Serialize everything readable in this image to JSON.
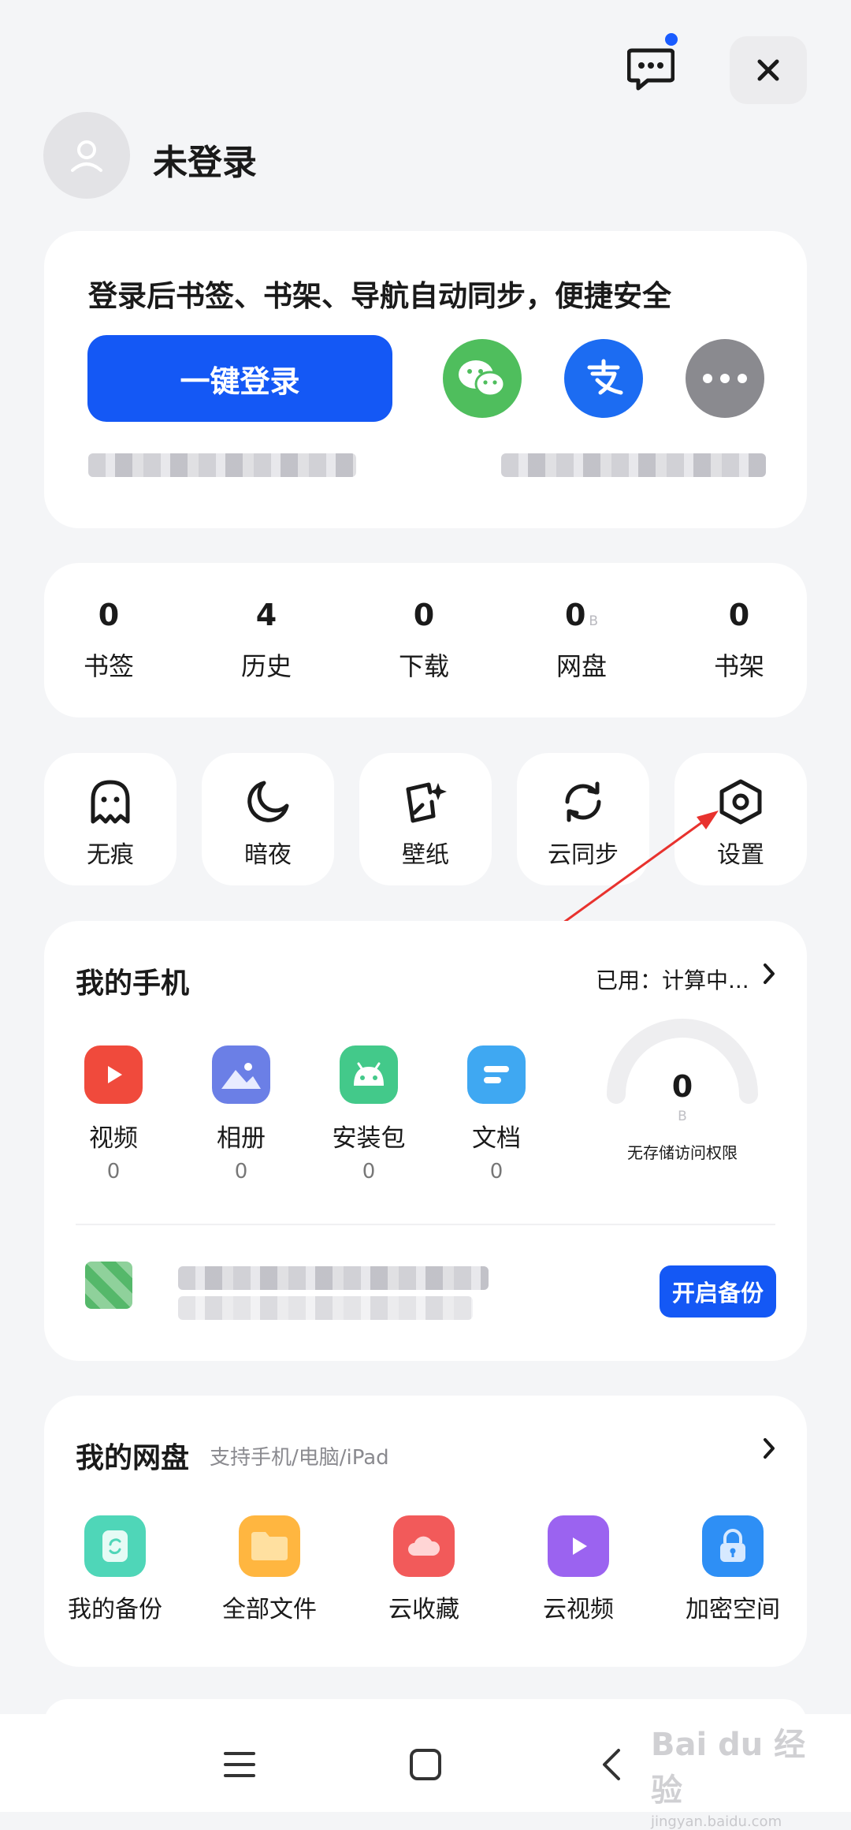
{
  "header": {
    "username": "未登录",
    "message_icon": "chat-bubble-icon",
    "close_icon": "close-icon"
  },
  "login_card": {
    "tip": "登录后书签、书架、导航自动同步，便捷安全",
    "login_button": "一键登录",
    "oauth": [
      {
        "name": "wechat",
        "icon": "wechat-icon",
        "color": "#4fbe5d"
      },
      {
        "name": "alipay",
        "icon": "alipay-icon",
        "color": "#1c6cf2"
      },
      {
        "name": "more",
        "icon": "more-dots-icon",
        "color": "#8a8a8f"
      }
    ]
  },
  "stats": [
    {
      "value": "0",
      "unit": "",
      "label": "书签"
    },
    {
      "value": "4",
      "unit": "",
      "label": "历史"
    },
    {
      "value": "0",
      "unit": "",
      "label": "下载"
    },
    {
      "value": "0",
      "unit": "B",
      "label": "网盘"
    },
    {
      "value": "0",
      "unit": "",
      "label": "书架"
    }
  ],
  "tools": [
    {
      "label": "无痕",
      "icon": "ghost-icon"
    },
    {
      "label": "暗夜",
      "icon": "moon-icon"
    },
    {
      "label": "壁纸",
      "icon": "wallpaper-icon"
    },
    {
      "label": "云同步",
      "icon": "sync-icon"
    },
    {
      "label": "设置",
      "icon": "settings-hexagon-icon"
    }
  ],
  "my_phone": {
    "title": "我的手机",
    "used_text": "已用：计算中...",
    "items": [
      {
        "label": "视频",
        "count": "0",
        "icon": "video-icon",
        "color": "#f04a3c"
      },
      {
        "label": "相册",
        "count": "0",
        "icon": "album-icon",
        "color": "#6b7fe6"
      },
      {
        "label": "安装包",
        "count": "0",
        "icon": "android-icon",
        "color": "#43c98a"
      },
      {
        "label": "文档",
        "count": "0",
        "icon": "document-icon",
        "color": "#3fa8f2"
      }
    ],
    "storage_value": "0",
    "storage_unit": "B",
    "storage_note": "无存储访问权限",
    "backup_button": "开启备份"
  },
  "my_cloud": {
    "title": "我的网盘",
    "subtitle": "支持手机/电脑/iPad",
    "items": [
      {
        "label": "我的备份",
        "icon": "backup-icon",
        "color": "#4fd6b8"
      },
      {
        "label": "全部文件",
        "icon": "folder-icon",
        "color": "#ffb640"
      },
      {
        "label": "云收藏",
        "icon": "cloud-favorite-icon",
        "color": "#f25a5a"
      },
      {
        "label": "云视频",
        "icon": "cloud-video-icon",
        "color": "#9b63f0"
      },
      {
        "label": "加密空间",
        "icon": "lock-icon",
        "color": "#2e8ff5"
      }
    ]
  },
  "watermark": "Bai du 经验",
  "watermark_sub": "jingyan.baidu.com"
}
